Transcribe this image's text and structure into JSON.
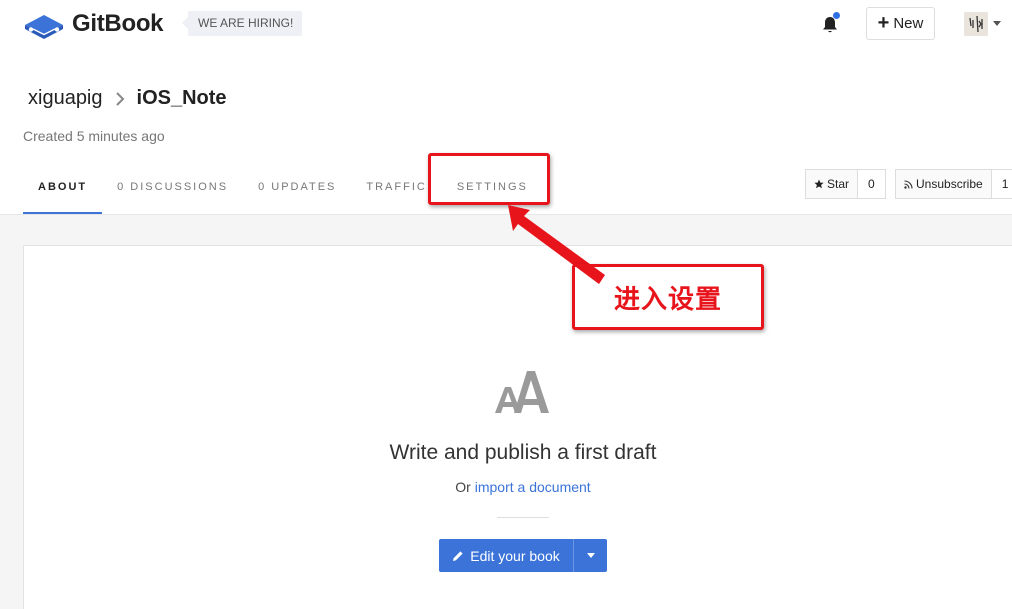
{
  "header": {
    "logo_text": "GitBook",
    "hiring_badge": "WE ARE HIRING!",
    "new_button": "New",
    "bell_has_notification": true
  },
  "breadcrumb": {
    "user": "xiguapig",
    "book": "iOS_Note"
  },
  "meta": {
    "created": "Created 5 minutes ago"
  },
  "tabs": [
    {
      "label": "ABOUT",
      "active": true
    },
    {
      "label": "0 DISCUSSIONS",
      "active": false
    },
    {
      "label": "0 UPDATES",
      "active": false
    },
    {
      "label": "TRAFFIC",
      "active": false
    },
    {
      "label": "SETTINGS",
      "active": false
    }
  ],
  "actions": {
    "star_label": "Star",
    "star_count": "0",
    "unsubscribe_label": "Unsubscribe",
    "unsubscribe_count": "1"
  },
  "empty_state": {
    "headline": "Write and publish a first draft",
    "sub_prefix": "Or",
    "import_link": "import a document",
    "edit_button": "Edit your book"
  },
  "annotation": {
    "label": "进入设置",
    "color": "#e8141b"
  },
  "colors": {
    "accent": "#3b73d9",
    "annotation": "#e8141b"
  }
}
